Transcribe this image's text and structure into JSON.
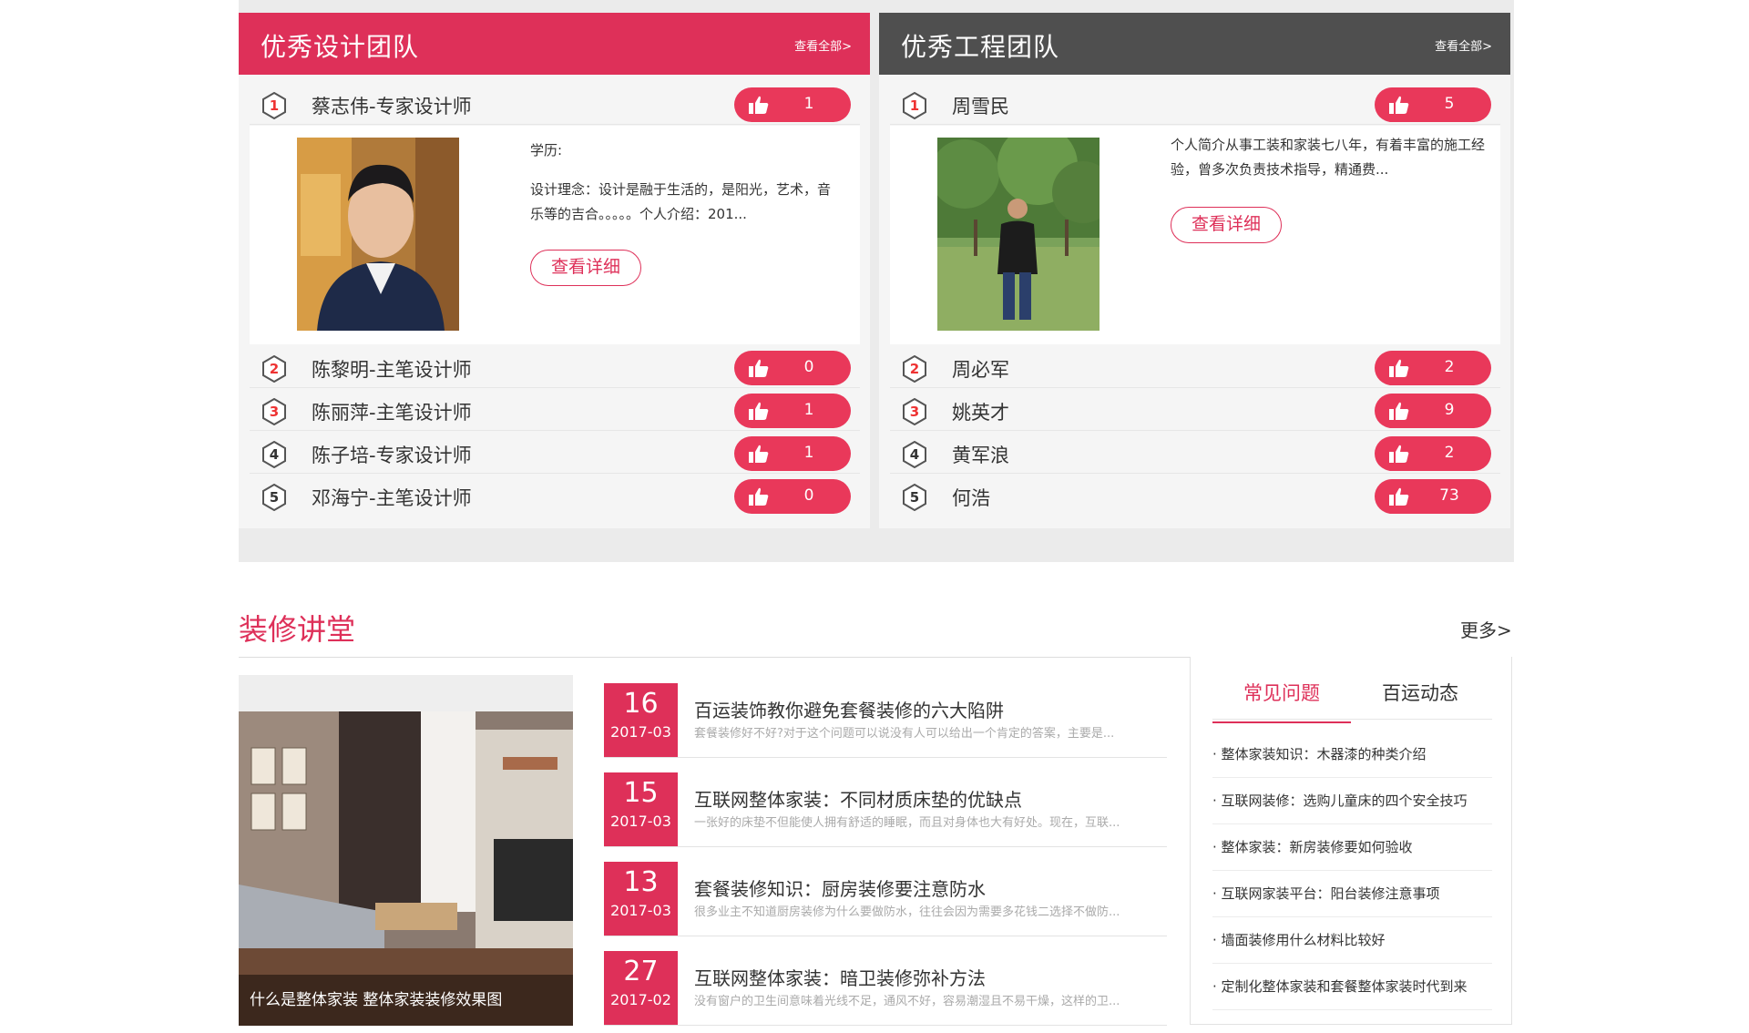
{
  "design_team": {
    "title": "优秀设计团队",
    "more": "查看全部>",
    "featured": {
      "rank": "1",
      "name": "蔡志伟-专家设计师",
      "likes": "1",
      "education": "学历:",
      "description": "设计理念：设计是融于生活的，是阳光，艺术，音乐等的吉合。。。。。个人介绍：201...",
      "detail_label": "查看详细"
    },
    "members": [
      {
        "rank": "2",
        "name": "陈黎明-主笔设计师",
        "likes": "0"
      },
      {
        "rank": "3",
        "name": "陈丽萍-主笔设计师",
        "likes": "1"
      },
      {
        "rank": "4",
        "name": "陈子培-专家设计师",
        "likes": "1"
      },
      {
        "rank": "5",
        "name": "邓海宁-主笔设计师",
        "likes": "0"
      }
    ]
  },
  "engineering_team": {
    "title": "优秀工程团队",
    "more": "查看全部>",
    "featured": {
      "rank": "1",
      "name": "周雪民",
      "likes": "5",
      "description": "个人简介从事工装和家装七八年，有着丰富的施工经验，曾多次负责技术指导，精通费...",
      "detail_label": "查看详细"
    },
    "members": [
      {
        "rank": "2",
        "name": "周必军",
        "likes": "2"
      },
      {
        "rank": "3",
        "name": "姚英才",
        "likes": "9"
      },
      {
        "rank": "4",
        "name": "黄军浪",
        "likes": "2"
      },
      {
        "rank": "5",
        "name": "何浩",
        "likes": "73"
      }
    ]
  },
  "lecture": {
    "title": "装修讲堂",
    "more": "更多>",
    "photo_caption": "什么是整体家装 整体家装装修效果图",
    "news": [
      {
        "day": "16",
        "ym": "2017-03",
        "title": "百运装饰教你避免套餐装修的六大陷阱",
        "summary": "套餐装修好不好?对于这个问题可以说没有人可以给出一个肯定的答案，主要是..."
      },
      {
        "day": "15",
        "ym": "2017-03",
        "title": "互联网整体家装：不同材质床垫的优缺点",
        "summary": "一张好的床垫不但能使人拥有舒适的睡眠，而且对身体也大有好处。现在，互联..."
      },
      {
        "day": "13",
        "ym": "2017-03",
        "title": "套餐装修知识：厨房装修要注意防水",
        "summary": "很多业主不知道厨房装修为什么要做防水，往往会因为需要多花钱二选择不做防..."
      },
      {
        "day": "27",
        "ym": "2017-02",
        "title": "互联网整体家装：暗卫装修弥补方法",
        "summary": "没有窗户的卫生间意味着光线不足，通风不好，容易潮湿且不易干燥，这样的卫..."
      }
    ],
    "tabs": [
      "常见问题",
      "百运动态"
    ],
    "faq": [
      "· 整体家装知识：木器漆的种类介绍",
      "· 互联网装修：选购儿童床的四个安全技巧",
      "· 整体家装：新房装修要如何验收",
      "· 互联网家装平台：阳台装修注意事项",
      "· 墙面装修用什么材料比较好",
      "· 定制化整体家装和套餐整体家装时代到来"
    ]
  },
  "colors": {
    "accent": "#de3059",
    "dark_header": "#4f4f4f",
    "like_button": "#e9385a"
  }
}
